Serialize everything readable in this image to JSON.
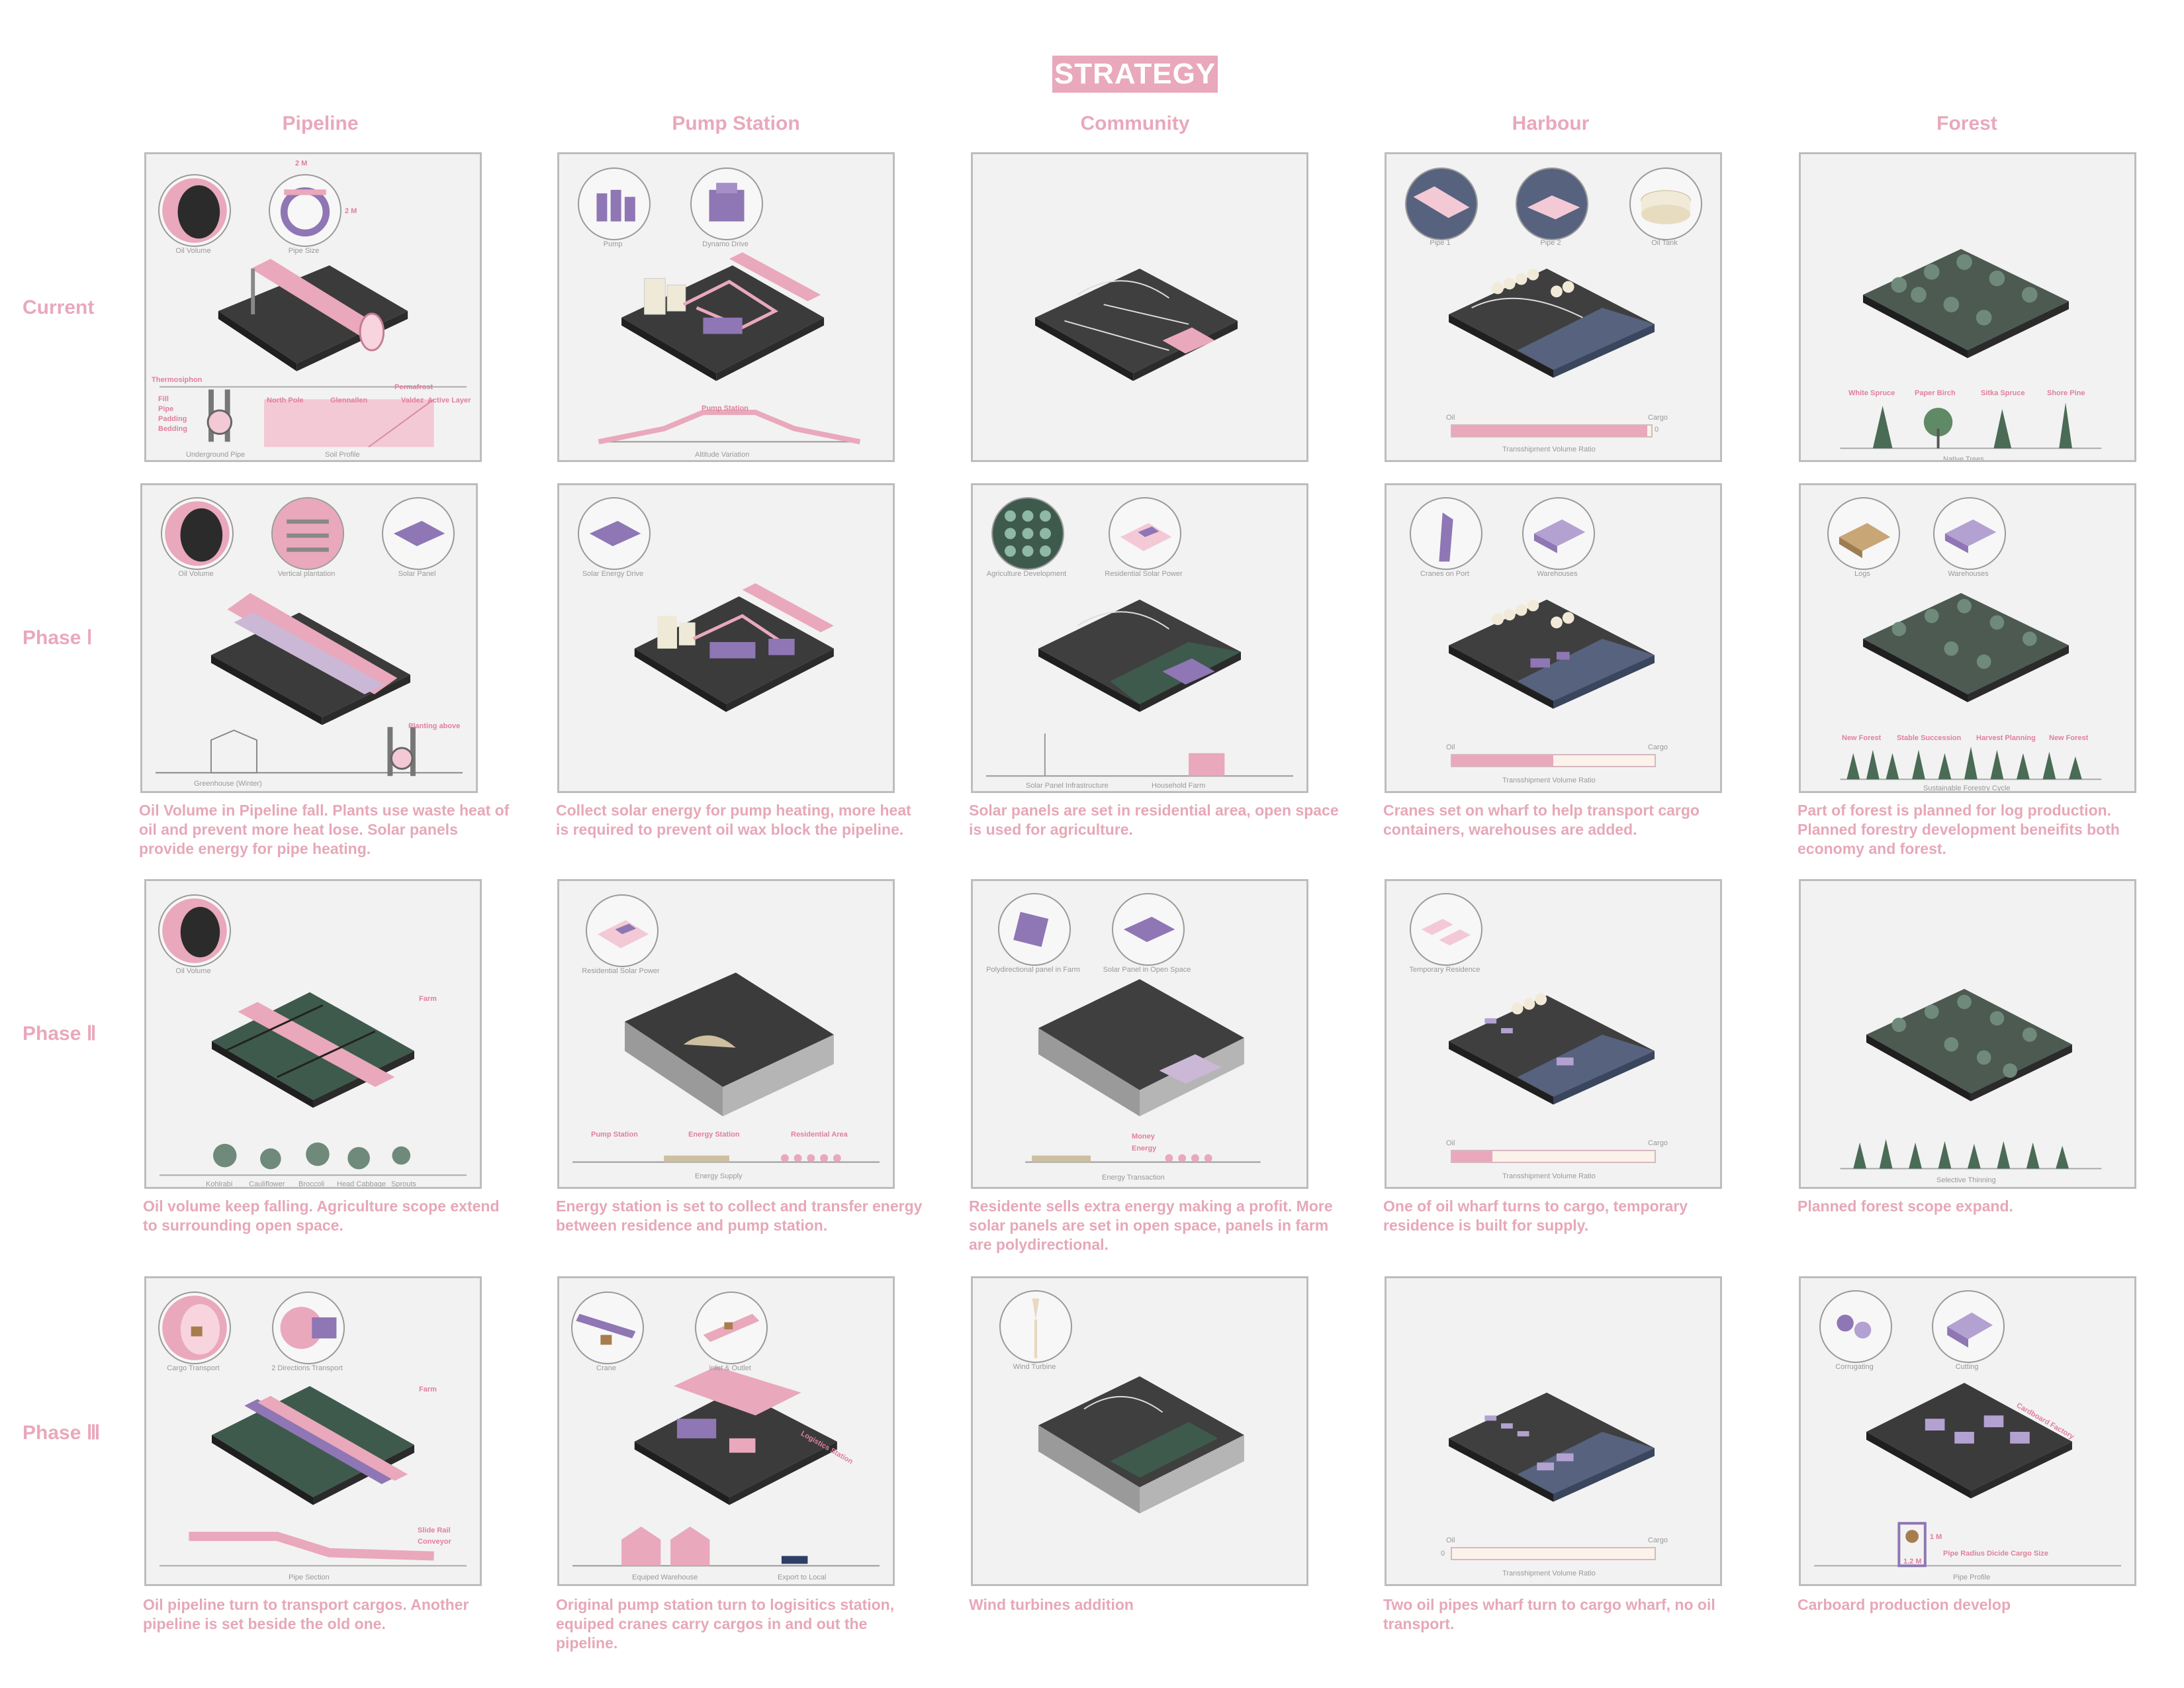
{
  "title": "STRATEGY",
  "columns": [
    "Pipeline",
    "Pump Station",
    "Community",
    "Harbour",
    "Forest"
  ],
  "rows": [
    "Current",
    "Phase Ⅰ",
    "Phase Ⅱ",
    "Phase Ⅲ"
  ],
  "colors": {
    "accent": "#e9a8bb",
    "purple": "#8f76b4",
    "ground": "#3a3a3a",
    "water": "#56627e",
    "panel_bg": "#f2f2f2"
  },
  "current": {
    "pipeline": {
      "c1": "Oil Volume",
      "c2": "Pipe Size",
      "dim1": "2 M",
      "dim2": "2 M",
      "thermo": "Thermosiphon",
      "fill": "Fill",
      "pipe": "Pipe",
      "padding": "Padding",
      "bedding": "Bedding",
      "north": "North Pole",
      "glennallen": "Glennallen",
      "valdez": "Valdez",
      "permafrost": "Permafrost",
      "active": "Active Layer",
      "under": "Underground Pipe",
      "soil": "Soil Profile"
    },
    "pump": {
      "c1": "Pump",
      "c2": "Dynamo Drive",
      "station": "Pump Station",
      "alt": "Altitude Variation"
    },
    "harbour": {
      "c1": "Pipe 1",
      "c2": "Pipe 2",
      "c3": "Oil Tank",
      "oil": "Oil",
      "cargo": "Cargo",
      "zero": "0",
      "ratio": "Transshipment Volume Ratio"
    },
    "forest": {
      "t1": "White Spruce",
      "t2": "Paper Birch",
      "t3": "Sitka Spruce",
      "t4": "Shore Pine",
      "native": "Native Trees"
    }
  },
  "phase1": {
    "pipeline": {
      "c1": "Oil Volume",
      "c2": "Vertical plantation",
      "c3": "Solar Panel",
      "planting": "Planting above",
      "green": "Greenhouse (Winter)",
      "desc": "Oil Volume in Pipeline fall. Plants use waste heat of oil and prevent more heat lose. Solar panels provide energy for pipe heating."
    },
    "pump": {
      "c1": "Solar Energy Drive",
      "desc": "Collect solar energy for pump heating, more heat is required to prevent oil wax block the pipeline."
    },
    "community": {
      "c1": "Agriculture Development",
      "c2": "Residential Solar Power",
      "infra": "Solar Panel Infrastructure",
      "farm": "Household Farm",
      "desc": "Solar panels are set in residential area, open space is used for agriculture."
    },
    "harbour": {
      "c1": "Cranes on Port",
      "c2": "Warehouses",
      "oil": "Oil",
      "cargo": "Cargo",
      "ratio": "Transshipment Volume Ratio",
      "desc": "Cranes set on wharf to help transport cargo containers, warehouses are added."
    },
    "forest": {
      "c1": "Logs",
      "c2": "Warehouses",
      "s1": "New Forest",
      "s2": "Stable Succession",
      "s3": "Harvest Planning",
      "s4": "New Forest",
      "cycle": "Sustainable Forestry Cycle",
      "desc": "Part of forest is planned for log production. Planned forestry development beneifits both economy and forest."
    }
  },
  "phase2": {
    "pipeline": {
      "c1": "Oil Volume",
      "farm": "Farm",
      "v1": "Kohlrabi",
      "v2": "Cauliflower",
      "v3": "Broccoli",
      "v4": "Head Cabbage",
      "v5": "Sprouts",
      "desc": "Oil volume keep falling. Agriculture scope extend to surrounding open space."
    },
    "pump": {
      "c1": "Residential Solar Power",
      "l1": "Pump Station",
      "l2": "Energy Station",
      "l3": "Residential Area",
      "supply": "Energy Supply",
      "desc": "Energy station is set to collect and transfer energy between residence and pump station."
    },
    "community": {
      "c1": "Polydirectional panel in Farm",
      "c2": "Solar Panel in Open Space",
      "money": "Money",
      "energy": "Energy",
      "trans": "Energy Transaction",
      "desc": "Residente sells extra energy making a profit. More solar panels are set in open space, panels in farm are polydirectional."
    },
    "harbour": {
      "c1": "Temporary Residence",
      "oil": "Oil",
      "cargo": "Cargo",
      "ratio": "Transshipment Volume Ratio",
      "desc": "One of oil wharf turns to cargo, temporary residence is built for supply."
    },
    "forest": {
      "thin": "Selective Thinning",
      "desc": "Planned forest scope expand."
    }
  },
  "phase3": {
    "pipeline": {
      "c1": "Cargo Transport",
      "c2": "2 Directions Transport",
      "farm": "Farm",
      "slide": "Slide Rail",
      "conv": "Conveyor",
      "section": "Pipe Section",
      "desc": "Oil pipeline turn to transport cargos. Another pipeline is set beside the old one."
    },
    "pump": {
      "c1": "Crane",
      "c2": "Inlet & Outlet",
      "logistics": "Logistics Station",
      "wh": "Equiped Warehouse",
      "export": "Export to Local",
      "desc": "Original pump station turn to logisitics station, equiped cranes carry cargos in and out the pipeline."
    },
    "community": {
      "c1": "Wind Turbine",
      "desc": "Wind turbines addition"
    },
    "harbour": {
      "oil": "Oil",
      "cargo": "Cargo",
      "zero": "0",
      "ratio": "Transshipment Volume Ratio",
      "desc": "Two oil pipes wharf turn to cargo wharf, no oil transport."
    },
    "forest": {
      "c1": "Corrugating",
      "c2": "Cutting",
      "factory": "Cardboard Factory",
      "dim": "1 M",
      "dim2": "1.2 M",
      "radius": "Pipe Radius Dicide Cargo Size",
      "profile": "Pipe Profile",
      "desc": "Carboard production develop"
    }
  },
  "ratios": {
    "current": 0.98,
    "phase1": 0.5,
    "phase2": 0.2,
    "phase3": 0.0
  }
}
